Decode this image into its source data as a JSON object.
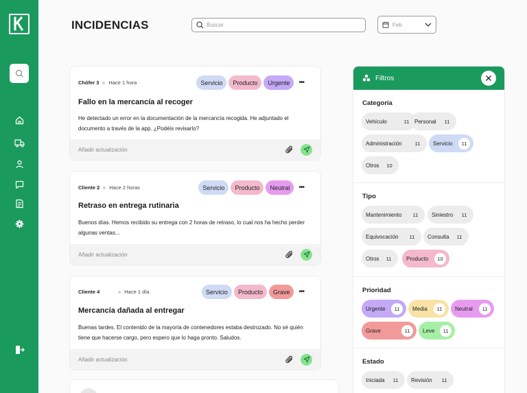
{
  "app": {
    "title": "INCIDENCIAS",
    "logo_letter": "k"
  },
  "search": {
    "placeholder": "Buscar",
    "value": ""
  },
  "date_filter": {
    "value": "Feb"
  },
  "sidebar": {
    "items": [
      "search-icon",
      "home-icon",
      "truck-icon",
      "user-icon",
      "chat-icon",
      "report-icon",
      "settings-icon",
      "logout-icon"
    ]
  },
  "cards": [
    {
      "author": "Chófer 3",
      "time": "Hace 1 hora",
      "tags": [
        {
          "label": "Servicio",
          "color": "#cfdaf5"
        },
        {
          "label": "Producto",
          "color": "#f4b9cc"
        },
        {
          "label": "Urgente",
          "color": "#c3a9f6"
        }
      ],
      "title": "Fallo en la mercancía al recoger",
      "body": "He detectado un error en la documentación de la mercancía recogida. He adjuntado el documento a través de la app. ¿Podéis revisarlo?",
      "footer": "Añadir actualización"
    },
    {
      "author": "Cliente 2",
      "time": "Hace 2 horas",
      "tags": [
        {
          "label": "Servicio",
          "color": "#cfdaf5"
        },
        {
          "label": "Producto",
          "color": "#f4b9cc"
        },
        {
          "label": "Neutral",
          "color": "#e79bef"
        }
      ],
      "title": "Retraso en entrega rutinaria",
      "body": "Buenos días. Hemos recibido su entrega con 2 horas de retraso, lo cual nos ha hecho perder algunas ventas...",
      "footer": "Añadir actualización"
    },
    {
      "author": "Cliente 4",
      "time": "Hace 1 día",
      "tags": [
        {
          "label": "Servicio",
          "color": "#cfdaf5"
        },
        {
          "label": "Producto",
          "color": "#f4b9cc"
        },
        {
          "label": "Grave",
          "color": "#f29a9a"
        }
      ],
      "title": "Mercancía dañada al entregar",
      "body": "Buenas tardes. El contenido de la mayoría de contenedores estaba destrozado. No sé quién tiene que hacerse cargo, pero espero que lo haga pronto. Saludos.",
      "footer": "Añadir actualización"
    }
  ],
  "filters": {
    "title": "Filtros",
    "categoria": {
      "title": "Categoría",
      "chips": [
        {
          "label": "Vehículo",
          "count": "11",
          "selected": false
        },
        {
          "label": "Personal",
          "count": "11",
          "selected": false
        },
        {
          "label": "Administración",
          "count": "11",
          "selected": false
        },
        {
          "label": "Servicio",
          "count": "11",
          "selected": true,
          "color": "#cfdaf5"
        },
        {
          "label": "Otros",
          "count": "10",
          "selected": false
        }
      ]
    },
    "tipo": {
      "title": "Tipo",
      "chips": [
        {
          "label": "Mantenimiento",
          "count": "11",
          "selected": false
        },
        {
          "label": "Siniestro",
          "count": "11",
          "selected": false
        },
        {
          "label": "Equivocación",
          "count": "11",
          "selected": false
        },
        {
          "label": "Consulta",
          "count": "11",
          "selected": false
        },
        {
          "label": "Otros",
          "count": "11",
          "selected": false
        },
        {
          "label": "Producto",
          "count": "10",
          "selected": true,
          "color": "#f4b9cc"
        }
      ]
    },
    "prioridad": {
      "title": "Prioridad",
      "chips": [
        {
          "label": "Urgente",
          "count": "11",
          "color": "#c3a9f6"
        },
        {
          "label": "Media",
          "count": "11",
          "color": "#f9e2a6"
        },
        {
          "label": "Neutral",
          "count": "11",
          "color": "#e79bef"
        },
        {
          "label": "Grave",
          "count": "11",
          "color": "#f29a9a"
        },
        {
          "label": "Leve",
          "count": "11",
          "color": "#a6f0a6"
        }
      ]
    },
    "estado": {
      "title": "Estado",
      "chips": [
        {
          "label": "Iniciada",
          "count": "11",
          "selected": false
        },
        {
          "label": "Revisión",
          "count": "11",
          "selected": false
        }
      ]
    }
  },
  "colors": {
    "brand": "#1a9a5c",
    "send_button": "#86e28f"
  }
}
